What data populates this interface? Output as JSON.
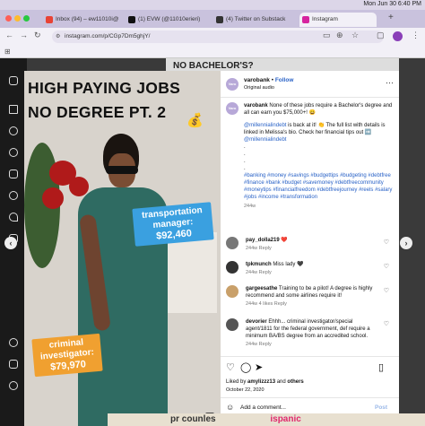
{
  "menubar": {
    "right_text": "Mon Jun 30  6:40 PM"
  },
  "tabs": [
    {
      "label": "Inbox (94) – ew11010i@",
      "fav": "gmail-icon",
      "color": "#e84335"
    },
    {
      "label": "(1) EVW (@11010erieri)",
      "fav": "x-icon",
      "color": "#111111"
    },
    {
      "label": "(4) Twitter on Substack",
      "fav": "substack-icon",
      "color": "#333333"
    },
    {
      "label": "Instagram",
      "fav": "instagram-icon",
      "color": "#d6249f"
    }
  ],
  "address": {
    "url": "instagram.com/p/CGp7Dm5ghjY/"
  },
  "background_text": {
    "top": "NO BACHELOR'S?",
    "bottom_left": "pr counles",
    "bottom_right": "ispanic"
  },
  "post_image": {
    "headline_line1": "HIGH PAYING JOBS",
    "headline_line2": "NO DEGREE PT. 2",
    "moneybag": "💰",
    "tag1_line1": "transportation",
    "tag1_line2": "manager:",
    "tag1_amount": "$92,460",
    "tag2_line1": "criminal",
    "tag2_line2": "investigator:",
    "tag2_amount": "$79,970"
  },
  "panel": {
    "avatar_text": "Varo",
    "username": "varobank",
    "follow_sep": "•",
    "follow": "Follow",
    "audio": "Original audio",
    "caption_username": "varobank",
    "caption_text": "None of these jobs require a Bachelor's degree and all can earn you $75,000+! 😀",
    "mention1": "@millennialindebt",
    "caption_text2": "is back at it! 👏 The full list with details is linked in Melissa's bio. Check her financial tips out ➡️",
    "mention2": "@millennialindebt",
    "dots": ".",
    "hashtags": "#banking #money #savings #budgettips #budgeting #debtfree #finance #bank #budget #savemoney #debtfreecommunity #moneytips #financialfreedom #debtfreejourney #reels #salary #jobs #income #transformation",
    "caption_time": "244w",
    "comments": [
      {
        "user": "pay_dolla219",
        "text": "❤️",
        "meta": "244w  Reply"
      },
      {
        "user": "tpkmunch",
        "text": "Miss lady 🖤",
        "meta": "244w  Reply"
      },
      {
        "user": "gargeesathe",
        "text": "Training to be a pilot! A degree is highly recommend and some airlines require it!",
        "meta": "244w  4 likes  Reply"
      },
      {
        "user": "devorier",
        "text": "Ehhh... criminal investigator/special agent/1811 for the federal government, def require a minimum BA/BS degree from an accredited school.",
        "meta": "244w  Reply"
      }
    ],
    "liked_by_prefix": "Liked by ",
    "liked_by_user": "amylizzz13",
    "liked_by_suffix": " and ",
    "liked_by_others": "others",
    "date": "October 22, 2020",
    "add_comment_placeholder": "Add a comment...",
    "post_label": "Post"
  }
}
